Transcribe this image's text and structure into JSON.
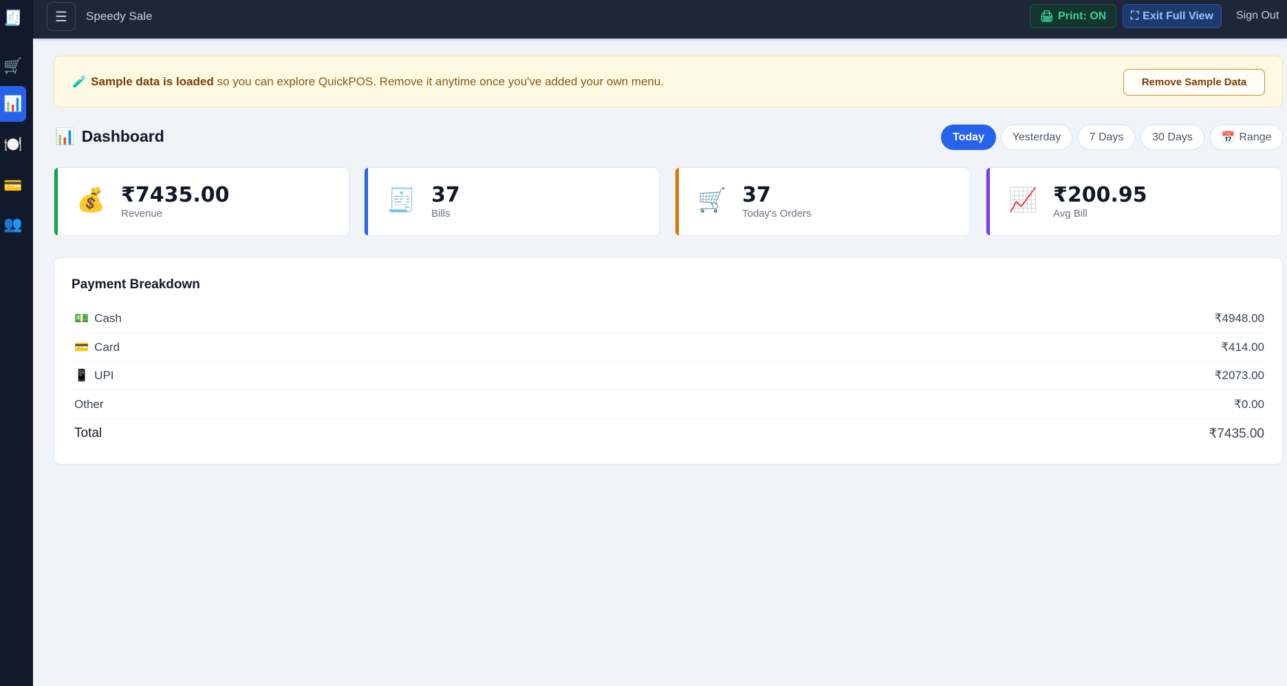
{
  "sidebar": {
    "items": [
      {
        "icon": "receipt-icon",
        "glyph": "🧾",
        "active": false
      },
      {
        "icon": "cart-icon",
        "glyph": "🛒",
        "active": false
      },
      {
        "icon": "bar-chart-icon",
        "glyph": "📊",
        "active": true
      },
      {
        "icon": "plate-icon",
        "glyph": "🍽️",
        "active": false
      },
      {
        "icon": "credit-card-icon",
        "glyph": "💳",
        "active": false
      },
      {
        "icon": "users-icon",
        "glyph": "👥",
        "active": false
      }
    ]
  },
  "topbar": {
    "menu_glyph": "☰",
    "brand": "Speedy Sale",
    "print_glyph": "🖨",
    "print_label": "Print: ON",
    "exit_glyph": "⛶",
    "exit_label": "Exit Full View",
    "signout_label": "Sign Out"
  },
  "banner": {
    "icon": "🧪",
    "bold": "Sample data is loaded",
    "text": " so you can explore QuickPOS. Remove it anytime once you've added your own menu.",
    "button": "Remove Sample Data"
  },
  "dashboard": {
    "icon": "📊",
    "title": "Dashboard",
    "ranges": [
      {
        "label": "Today",
        "active": true
      },
      {
        "label": "Yesterday",
        "active": false
      },
      {
        "label": "7 Days",
        "active": false
      },
      {
        "label": "30 Days",
        "active": false
      },
      {
        "label": "Range",
        "active": false,
        "icon": "📅"
      }
    ]
  },
  "stats": [
    {
      "icon": "💰",
      "value": "₹7435.00",
      "label": "Revenue",
      "accent": "#16a34a"
    },
    {
      "icon": "🧾",
      "value": "37",
      "label": "Bills",
      "accent": "#2563eb"
    },
    {
      "icon": "🛒",
      "value": "37",
      "label": "Today's Orders",
      "accent": "#d97706"
    },
    {
      "icon": "📈",
      "value": "₹200.95",
      "label": "Avg Bill",
      "accent": "#7c3aed"
    }
  ],
  "payment": {
    "title": "Payment Breakdown",
    "rows": [
      {
        "icon": "💵",
        "name": "Cash",
        "amount": "₹4948.00"
      },
      {
        "icon": "💳",
        "name": "Card",
        "amount": "₹414.00"
      },
      {
        "icon": "📱",
        "name": "UPI",
        "amount": "₹2073.00"
      },
      {
        "icon": "",
        "name": "Other",
        "amount": "₹0.00"
      }
    ],
    "total_label": "Total",
    "total_amount": "₹7435.00"
  },
  "colors": {
    "accent_blue": "#2563eb",
    "sidebar_bg": "#111a2c",
    "topbar_bg": "#1d2738",
    "banner_bg": "#fef9e3"
  }
}
